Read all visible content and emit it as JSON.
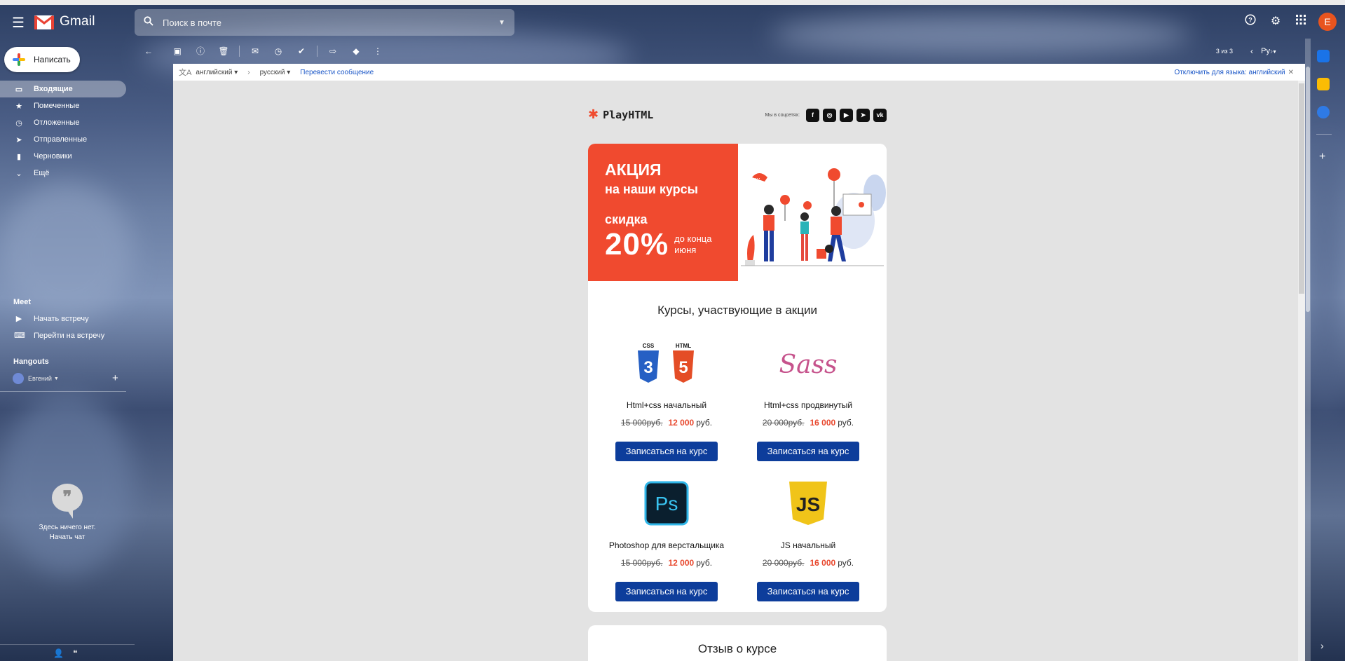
{
  "header": {
    "app_name": "Gmail",
    "search_placeholder": "Поиск в почте",
    "avatar_letter": "E"
  },
  "sidebar": {
    "compose_label": "Написать",
    "items": [
      {
        "label": "Входящие",
        "icon": "inbox-icon",
        "active": true
      },
      {
        "label": "Помеченные",
        "icon": "star-icon"
      },
      {
        "label": "Отложенные",
        "icon": "clock-icon"
      },
      {
        "label": "Отправленные",
        "icon": "send-icon"
      },
      {
        "label": "Черновики",
        "icon": "draft-icon"
      },
      {
        "label": "Ещё",
        "icon": "chevron-down-icon"
      }
    ],
    "meet_title": "Meet",
    "meet_items": [
      "Начать встречу",
      "Перейти на встречу"
    ],
    "hangouts_title": "Hangouts",
    "hangouts_user": "Евгений",
    "empty_chat_line1": "Здесь ничего нет.",
    "empty_chat_line2": "Начать чат"
  },
  "toolbar": {
    "pagination": "3 из 3",
    "lang_button": "Ру"
  },
  "translate": {
    "from": "английский",
    "to": "русский",
    "translate_link": "Перевести сообщение",
    "disable_label": "Отключить для языка: английский"
  },
  "email": {
    "brand": "PlayHTML",
    "social_label": "Мы в соцсетях:",
    "socials": [
      "f",
      "ig",
      "yt",
      "tg",
      "vk"
    ],
    "promo": {
      "line1": "АКЦИЯ",
      "line2": "на наши курсы",
      "line3": "скидка",
      "percent": "20%",
      "until_1": "до конца",
      "until_2": "июня"
    },
    "courses_title": "Курсы, участвующие в акции",
    "courses": [
      {
        "name": "Html+css начальный",
        "old": "15 000руб.",
        "new": "12 000",
        "cur": "руб.",
        "button": "Записаться на курс"
      },
      {
        "name": "Html+css продвинутый",
        "old": "20 000руб.",
        "new": "16 000",
        "cur": "руб.",
        "button": "Записаться на курс"
      },
      {
        "name": "Photoshop для верстальщика",
        "old": "15 000руб.",
        "new": "12 000",
        "cur": "руб.",
        "button": "Записаться на курс"
      },
      {
        "name": "JS начальный",
        "old": "20 000руб.",
        "new": "16 000",
        "cur": "руб.",
        "button": "Записаться на курс"
      }
    ],
    "review_title": "Отзыв о курсе"
  },
  "colors": {
    "promo_red": "#f04a2f",
    "button_blue": "#0d3d9b",
    "gmail_red": "#ea4335"
  }
}
